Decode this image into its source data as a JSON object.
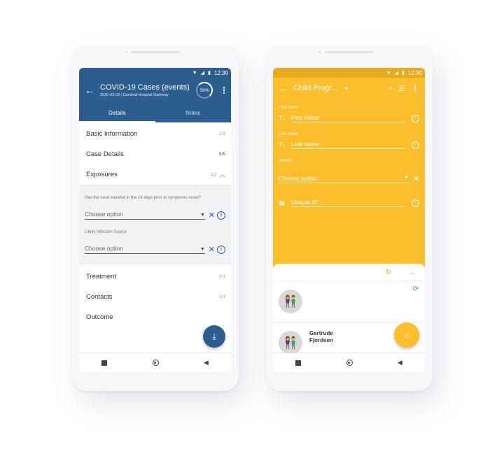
{
  "left_phone": {
    "status_time": "12:30",
    "title": "COVID-19 Cases (events)",
    "subtitle": "2020-03-20 | Cardinal Hospital Gateway",
    "progress": "56%",
    "tabs": [
      "Details",
      "Notes"
    ],
    "sections_top": [
      {
        "label": "Basic Information",
        "count": "2/3"
      },
      {
        "label": "Case Details",
        "count": "5/5"
      },
      {
        "label": "Exposures",
        "count": "0/2"
      }
    ],
    "questions": [
      {
        "label": "Has the case traveled in the 14 days prior to symptoms onset?",
        "placeholder": "Choose option"
      },
      {
        "label": "Likely Infection Source",
        "placeholder": "Choose option"
      }
    ],
    "sections_bottom": [
      {
        "label": "Treatment",
        "count": "0/1"
      },
      {
        "label": "Contacts",
        "count": "0/1"
      },
      {
        "label": "Outcome",
        "count": ""
      }
    ],
    "fab_icon": "download-icon"
  },
  "right_phone": {
    "status_time": "12:30",
    "title": "Child Progr...",
    "fields": {
      "first_name_label": "First name",
      "first_name_placeholder": "First name",
      "last_name_label": "Last name",
      "last_name_placeholder": "Last name",
      "gender_label": "Gender",
      "gender_placeholder": "Choose option",
      "unique_id_placeholder": "Unique ID"
    },
    "result_name": "Gertrude\nFjordsen",
    "fab_icon": "search-icon"
  },
  "colors": {
    "primary_blue": "#2c5d8f",
    "accent_yellow": "#fbbf2d",
    "sync_green": "#3db35e"
  }
}
